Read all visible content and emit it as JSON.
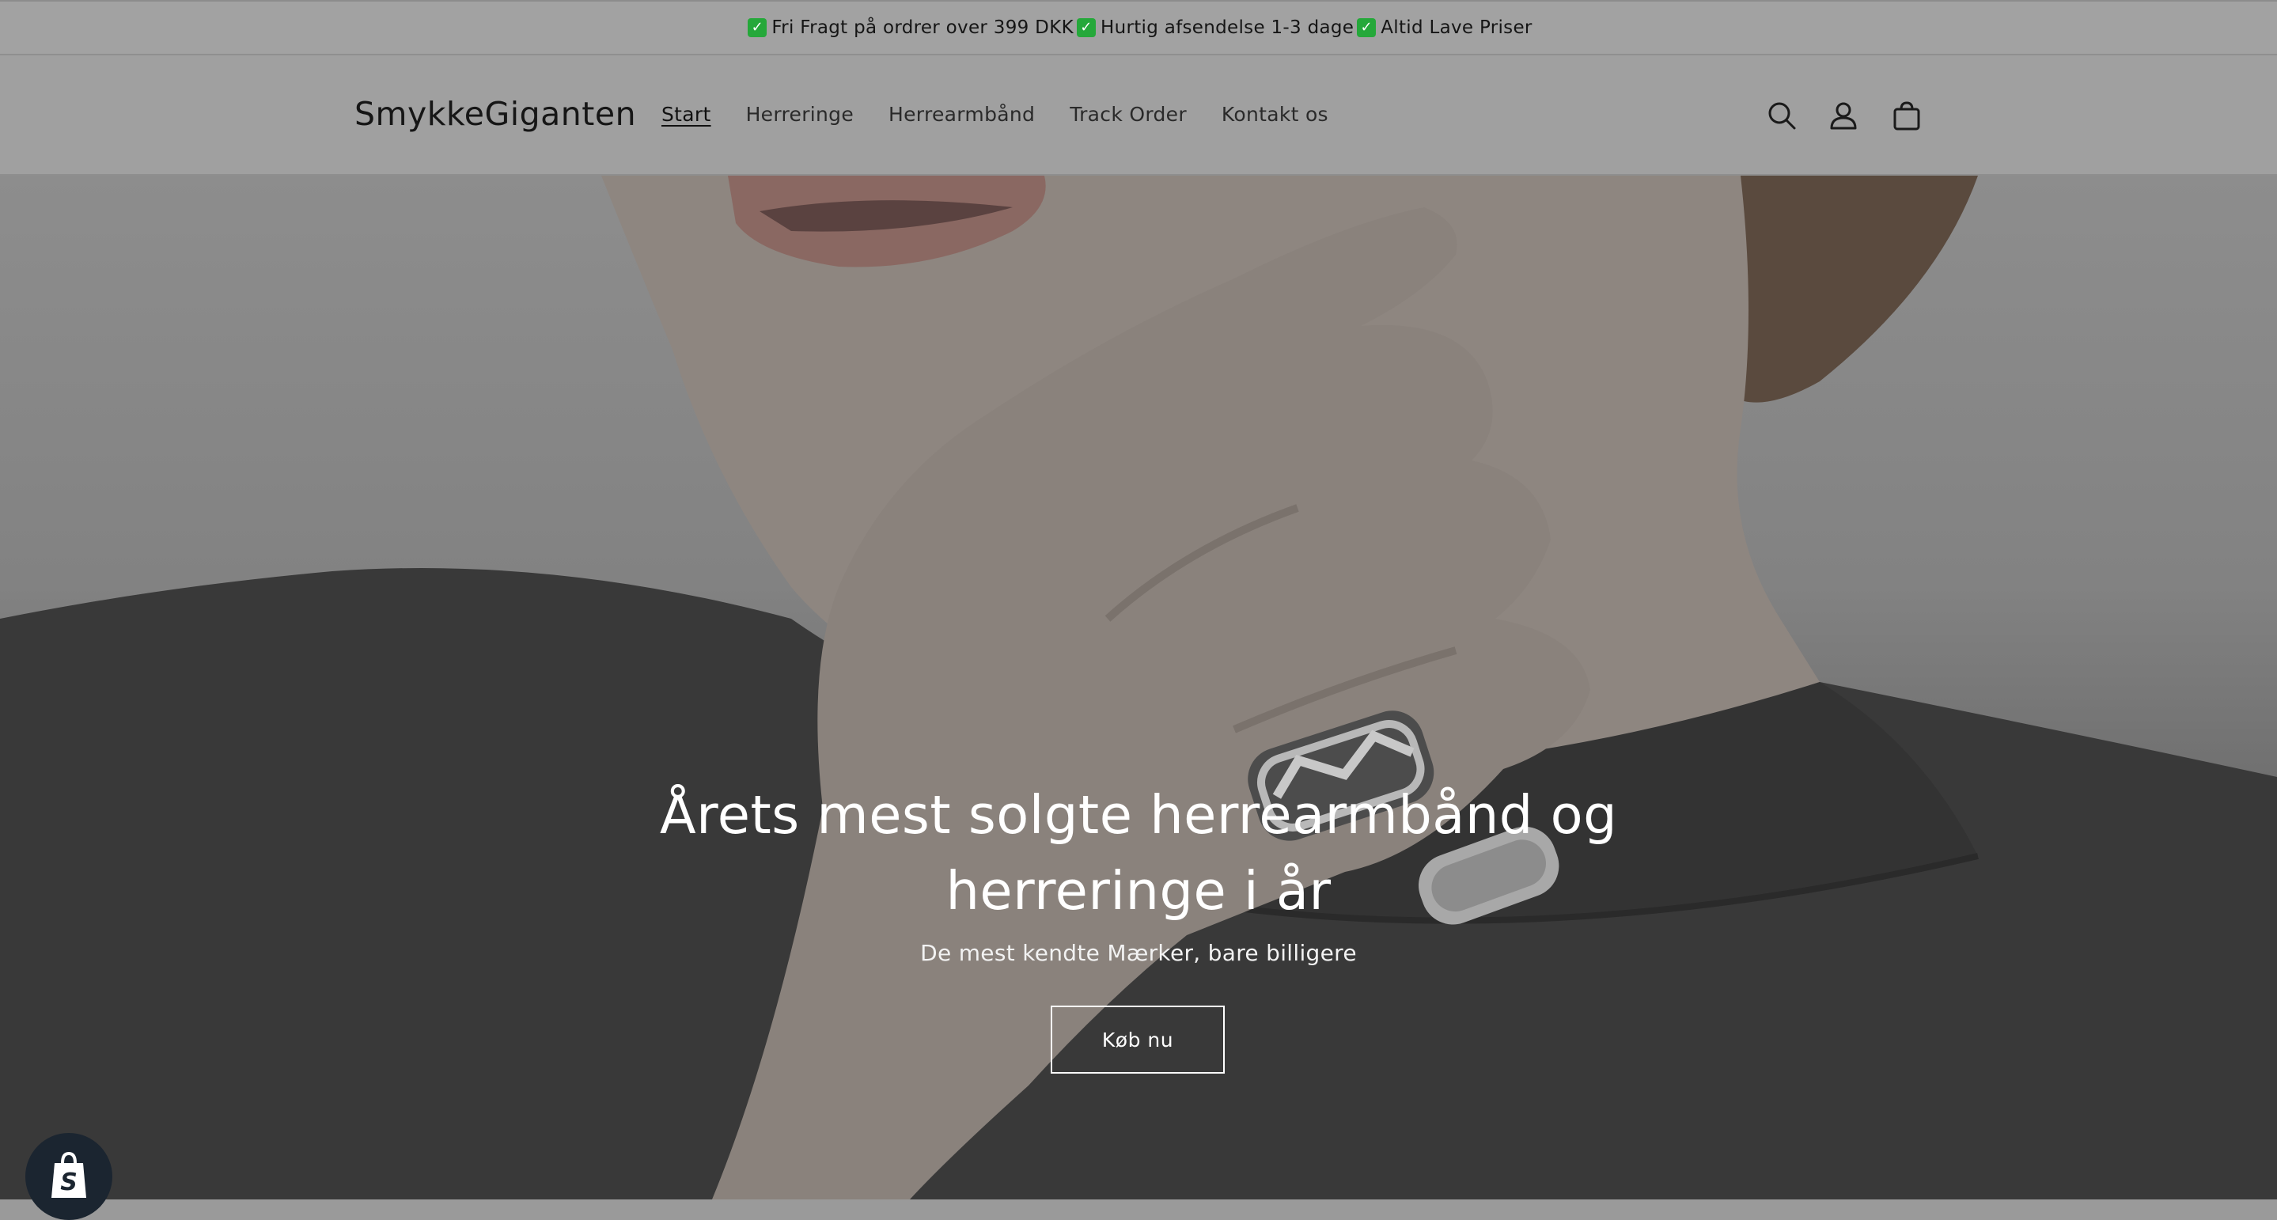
{
  "announcement": {
    "items": [
      "Fri Fragt på ordrer over 399 DKK",
      "Hurtig afsendelse 1-3 dage",
      "Altid Lave Priser"
    ],
    "icon": "check-mark-icon",
    "icon_color": "#25a83a"
  },
  "header": {
    "logo": "SmykkeGiganten",
    "nav": [
      {
        "label": "Start",
        "active": true
      },
      {
        "label": "Herreringe",
        "active": false
      },
      {
        "label": "Herrearmbånd",
        "active": false
      },
      {
        "label": "Track Order",
        "active": false
      },
      {
        "label": "Kontakt os",
        "active": false
      }
    ],
    "icons": [
      "search-icon",
      "account-icon",
      "cart-icon"
    ]
  },
  "hero": {
    "title": "Årets mest solgte herrearmbånd og herreringe i år",
    "subtitle": "De mest kendte Mærker, bare billigere",
    "button": "Køb nu"
  },
  "badge": {
    "icon": "shopify-bag-icon",
    "color": "#1b2530"
  }
}
